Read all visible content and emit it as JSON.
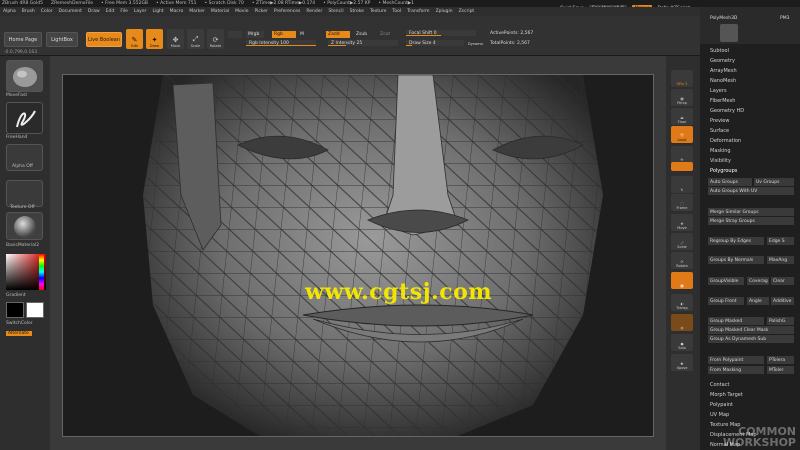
{
  "title_bar": {
    "app": "ZBrush 4R8 Gold5",
    "document": "ZRemeshDemoFile",
    "stats": [
      "• Free Mem 3.552GB",
      "• Active Mem 751",
      "• Scratch Disk 70",
      "• ZTime▶2.08 RTime▶0.174",
      "• PolyCount▶2.57 KP",
      "• MeshCount▶1"
    ],
    "quicksave": "QuickSave",
    "seethrough": "See-through  0",
    "menus": "Menus",
    "script": "DefaultZScript"
  },
  "menu_bar": [
    "Alpha",
    "Brush",
    "Color",
    "Document",
    "Draw",
    "Edit",
    "File",
    "Layer",
    "Light",
    "Macro",
    "Marker",
    "Material",
    "Movie",
    "Picker",
    "Preferences",
    "Render",
    "Stencil",
    "Stroke",
    "Texture",
    "Tool",
    "Transform",
    "Zplugin",
    "Zscript"
  ],
  "toolbar": {
    "home_page": "Home Page",
    "lightbox": "LightBox",
    "live_boolean": "Live Boolean",
    "edit": "Edit",
    "draw": "Draw",
    "move": "Move",
    "scale": "Scale",
    "rotate": "Rotate",
    "mrgb": "Mrgb",
    "rgb": "Rgb",
    "m": "M",
    "zadd": "Zadd",
    "zsub": "Zsub",
    "zcut": "Zcut",
    "rgb_intensity": "Rgb Intensity 100",
    "z_intensity": "Z Intensity 25",
    "focal_shift": "Focal Shift 0",
    "draw_size": "Draw Size 4",
    "dynamic": "Dynamic",
    "active_points": "ActivePoints: 2,567",
    "total_points": "TotalPoints: 2,567",
    "coord": "-0.0,799,0.163"
  },
  "left_shelf": {
    "brush": "MoveFast",
    "stroke": "FreeHand",
    "alpha": "Alpha Off",
    "texture": "Texture Off",
    "material": "BasicMaterial2",
    "gradient": "Gradient",
    "switch_color": "SwitchColor",
    "alternate": "Alternate"
  },
  "right_shelf": [
    "SPix 3",
    "Persp",
    "Floor",
    "Local",
    "Frame",
    "Move",
    "Scale",
    "Rotate",
    "Transp",
    "Solo",
    "Xpose"
  ],
  "panel": {
    "top_tool": "PolyMesh3D",
    "top_tool2": "PM3",
    "items_top": [
      "Subtool",
      "Geometry",
      "ArrayMesh",
      "NanoMesh",
      "Layers",
      "FiberMesh",
      "Geometry HD",
      "Preview",
      "Surface",
      "Deformation",
      "Masking",
      "Visibility",
      "Polygroups"
    ],
    "polygroups": {
      "auto_groups": "Auto Groups",
      "uv_groups": "Uv Groups",
      "auto_groups_uv": "Auto Groups With UV",
      "merge_similar": "Merge Similar Groups",
      "merge_stray": "Merge Stray Groups",
      "regroup_edges": "Regroup By Edges",
      "edge_s": "Edge S",
      "groups_normals": "Groups By Normals",
      "max_ang": "MaxAng",
      "group_visible": "GroupVisible",
      "coverage": "Coverag",
      "clear": "Clear",
      "group_front": "Group Front",
      "angle": "Angle",
      "additive": "Additive",
      "group_masked": "Group Masked",
      "polish_g": "PolishG",
      "group_masked_clear": "Group Masked Clear Mask",
      "group_dynamesh": "Group As Dynamesh Sub",
      "from_polypaint": "From Polypaint",
      "p_tolerance": "PTolera",
      "from_masking": "From Masking",
      "m_tolerance": "MToler"
    },
    "items_bottom": [
      "Contact",
      "Morph Target",
      "Polypaint",
      "UV Map",
      "Texture Map",
      "Displacement Map",
      "Normal Map"
    ]
  },
  "watermark": "www.cgtsj.com",
  "watermark2": [
    "COMMON",
    "WORKSHOP"
  ],
  "colors": {
    "accent": "#e88a1a",
    "panel": "#1f1f1f",
    "watermark": "#f2e600"
  }
}
